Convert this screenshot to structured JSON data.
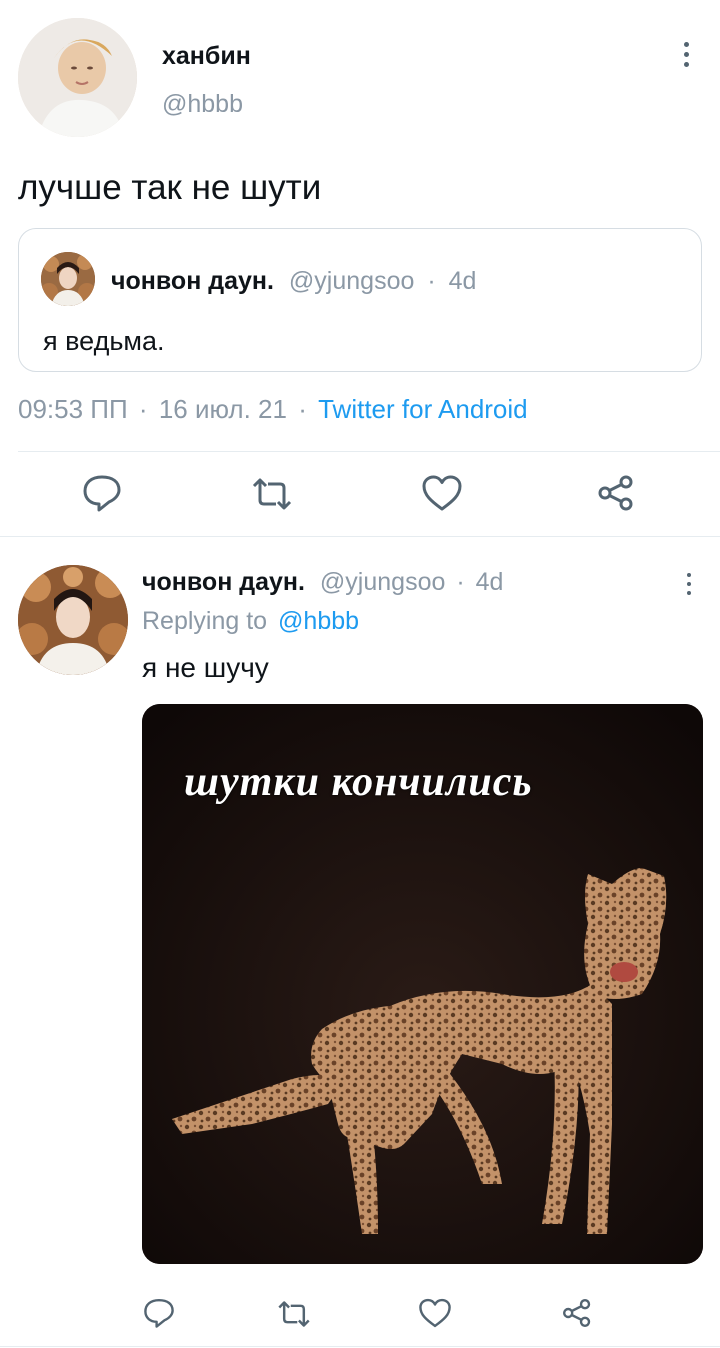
{
  "main_tweet": {
    "display_name": "ханбин",
    "handle": "@hbbb",
    "text": "лучше так не шути",
    "quoted": {
      "display_name": "чонвон даун.",
      "handle": "@yjungsoo",
      "separator": "·",
      "age": "4d",
      "text": "я ведьма."
    },
    "meta": {
      "time": "09:53 ПП",
      "sep1": "·",
      "date": "16 июл. 21",
      "sep2": "·",
      "client": "Twitter for Android"
    }
  },
  "reply": {
    "display_name": "чонвон даун.",
    "handle": "@yjungsoo",
    "separator": "·",
    "age": "4d",
    "replying_prefix": "Replying to",
    "replying_to": "@hbbb",
    "text": "я не шучу",
    "image_caption": "шутки кончились"
  },
  "icons": [
    "reply-icon",
    "retweet-icon",
    "like-icon",
    "share-icon",
    "more-icon"
  ],
  "colors": {
    "link": "#1d9bf0",
    "muted": "#8b98a5",
    "text": "#0f1419",
    "divider": "#e6ecf0",
    "icon": "#536471"
  }
}
